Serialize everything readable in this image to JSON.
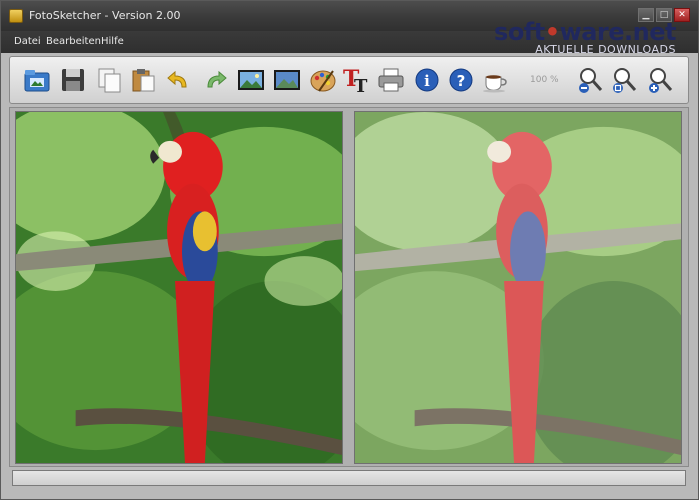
{
  "window": {
    "title": "FotoSketcher - Version 2.00",
    "buttons": {
      "minimize": "▁",
      "maximize": "□",
      "close": "✕"
    }
  },
  "menu": {
    "items": [
      "Datei",
      "Bearbeiten",
      "Hilfe"
    ]
  },
  "watermark": {
    "brand": "soft",
    "brand_separator": "•",
    "brand_tail": "ware.net",
    "tagline": "AKTUELLE DOWNLOADS"
  },
  "toolbar": {
    "icons": [
      "open-image-icon",
      "save-icon",
      "copy-icon",
      "paste-icon",
      "undo-icon",
      "redo-icon",
      "original-image-icon",
      "result-image-icon",
      "palette-icon",
      "text-icon",
      "print-icon",
      "info-icon",
      "help-icon",
      "coffee-icon",
      "zoom-out-icon",
      "zoom-fit-icon",
      "zoom-in-icon"
    ],
    "zoom_label": "100 %"
  },
  "colors": {
    "titlebar": "#3a3a3a",
    "accent": "#1f5fae",
    "brand": "#20285e"
  }
}
